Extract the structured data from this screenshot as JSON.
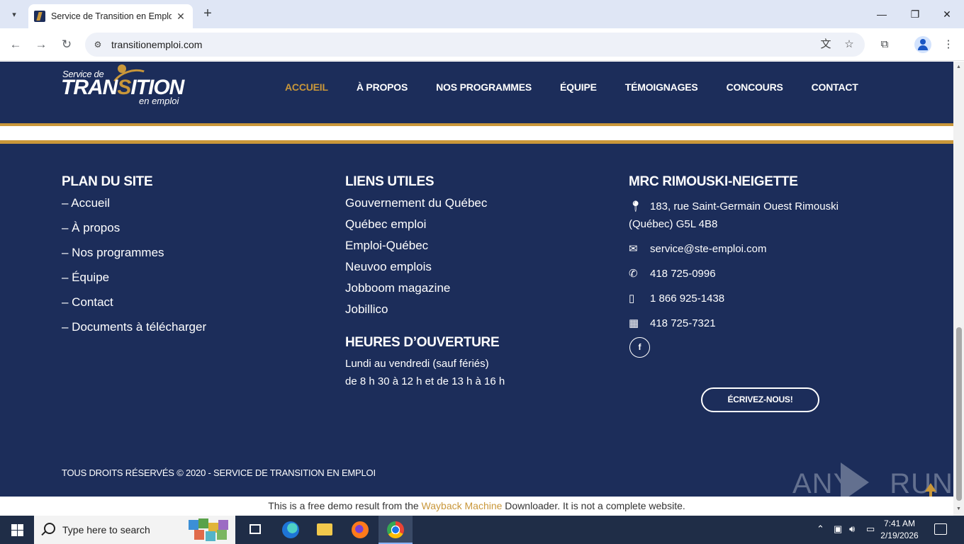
{
  "browser": {
    "tab_title": "Service de Transition en Emploi",
    "url": "transitionemploi.com",
    "new_tab_symbol": "+",
    "tab_close_symbol": "✕",
    "minimize_symbol": "—",
    "maximize_symbol": "❐",
    "close_symbol": "✕",
    "back_symbol": "←",
    "forward_symbol": "→",
    "reload_symbol": "↻",
    "menu_symbol": "⋮",
    "star_symbol": "☆",
    "translate_symbol": "文",
    "extensions_symbol": "⧉",
    "tab_list_symbol": "▾",
    "site_info_symbol": "⚙"
  },
  "header": {
    "logo_small": "Service de",
    "logo_big_a": "TRAN",
    "logo_big_b": "S",
    "logo_big_c": "ITION",
    "logo_sub": "en emploi",
    "nav": [
      "ACCUEIL",
      "À PROPOS",
      "NOS PROGRAMMES",
      "ÉQUIPE",
      "TÉMOIGNAGES",
      "CONCOURS",
      "CONTACT"
    ],
    "active_nav": "ACCUEIL"
  },
  "footer": {
    "sitemap": {
      "title": "PLAN DU SITE",
      "items": [
        "– Accueil",
        "– À propos",
        "– Nos programmes",
        "– Équipe",
        "– Contact",
        "– Documents à télécharger"
      ]
    },
    "links": {
      "title": "LIENS UTILES",
      "items": [
        "Gouvernement du Québec",
        "Québec emploi",
        "Emploi-Québec",
        "Neuvoo emplois",
        "Jobboom magazine",
        "Jobillico"
      ]
    },
    "hours": {
      "title": "HEURES D’OUVERTURE",
      "line1": "Lundi au vendredi (sauf fériés)",
      "line2": "de 8 h 30 à 12 h et de 13 h à 16 h"
    },
    "contact": {
      "title": "MRC RIMOUSKI-NEIGETTE",
      "address_line1": "183, rue Saint-Germain Ouest Rimouski",
      "address_line2": "(Québec) G5L 4B8",
      "email": "service@ste-emploi.com",
      "phone": "418 725-0996",
      "mobile": "1 866 925-1438",
      "fax": "418 725-7321",
      "facebook_label": "f",
      "write_button": "ÉCRIVEZ-NOUS!"
    },
    "copyright": "TOUS DROITS RÉSERVÉS © 2020 - SERVICE DE TRANSITION EN EMPLOI"
  },
  "watermark": {
    "left": "ANY",
    "right": "RUN"
  },
  "demo_bar": {
    "prefix": "This is a free demo result from the ",
    "link": "Wayback Machine",
    "suffix": " Downloader. It is not a complete website."
  },
  "taskbar": {
    "search_placeholder": "Type here to search",
    "time": "7:41 AM",
    "date": "2/19/2026",
    "tray_chevron": "⌃"
  },
  "colors": {
    "navy": "#1c2d5a",
    "gold": "#c9973a",
    "taskbar": "#1f2d47"
  }
}
